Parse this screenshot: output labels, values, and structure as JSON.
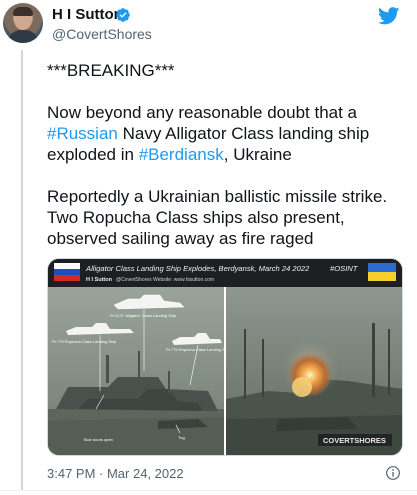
{
  "author": {
    "display_name": "H I Sutton",
    "handle": "@CovertShores"
  },
  "icons": {
    "verified": "verified-badge-icon",
    "brand": "twitter-bird-icon",
    "info": "info-icon"
  },
  "tweet": {
    "line1": "***BREAKING***",
    "p2_a": "Now beyond any reasonable doubt that a ",
    "p2_hashtag1": "#Russian",
    "p2_b": " Navy Alligator Class landing ship exploded in ",
    "p2_hashtag2": "#Berdiansk",
    "p2_c": ", Ukraine",
    "p3": "Reportedly a Ukrainian ballistic missile strike. Two Ropucha Class ships also present, observed sailing away as fire raged"
  },
  "media": {
    "banner_title": "Alligator Class Landing Ship Explodes, Berdyansk, March 24 2022",
    "banner_tag": "#OSINT",
    "banner_credit": "H I Sutton",
    "banner_credit_sub": "@CovertShores Website: www.hisutton.com",
    "label_alligator": "Pr.1171 'Alligator' Class Landing Ship",
    "label_ropucha1": "Pr.775 Ropucha Class Landing Ship",
    "label_ropucha2": "Pr.775 Ropucha Class Landing Ship",
    "label_bow": "Bow doors open",
    "label_tug": "Tug",
    "watermark": "COVERTSHORES"
  },
  "timestamp": "3:47 PM · Mar 24, 2022",
  "colors": {
    "link": "#1d9bf0",
    "secondary_text": "#536471",
    "twitter_blue": "#1d9bf0"
  }
}
